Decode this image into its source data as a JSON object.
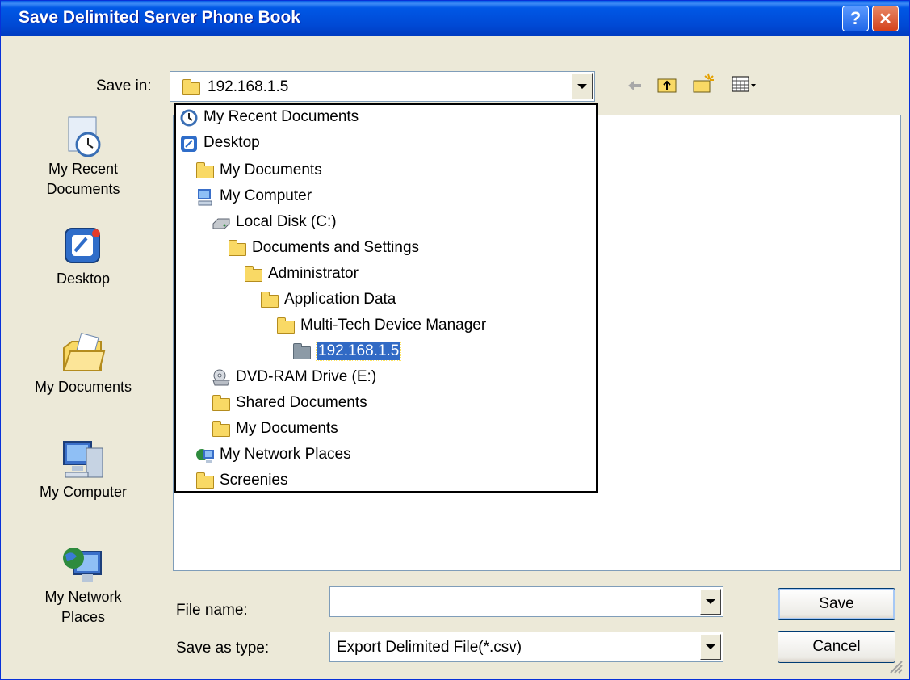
{
  "window": {
    "title": "Save Delimited Server Phone Book",
    "help_label": "?",
    "close_label": "✕"
  },
  "save_in": {
    "label": "Save in:",
    "value": "192.168.1.5"
  },
  "places_bar": [
    {
      "label": "My Recent Documents",
      "line1": "My Recent",
      "line2": "Documents",
      "icon": "recent-documents-icon"
    },
    {
      "label": "Desktop",
      "line1": "Desktop",
      "line2": "",
      "icon": "desktop-icon"
    },
    {
      "label": "My Documents",
      "line1": "My Documents",
      "line2": "",
      "icon": "my-documents-icon"
    },
    {
      "label": "My Computer",
      "line1": "My Computer",
      "line2": "",
      "icon": "my-computer-icon"
    },
    {
      "label": "My Network Places",
      "line1": "My Network",
      "line2": "Places",
      "icon": "network-places-icon"
    }
  ],
  "dropdown_items": [
    {
      "label": "My Recent Documents",
      "icon": "recent-documents-icon",
      "selected": false
    },
    {
      "label": "Desktop",
      "icon": "desktop-icon",
      "selected": false
    },
    {
      "label": "My Documents",
      "icon": "my-documents-icon",
      "selected": false
    },
    {
      "label": "My Computer",
      "icon": "my-computer-icon",
      "selected": false
    },
    {
      "label": "Local Disk (C:)",
      "icon": "hard-disk-icon",
      "selected": false
    },
    {
      "label": "Documents and Settings",
      "icon": "folder-icon",
      "selected": false
    },
    {
      "label": "Administrator",
      "icon": "folder-icon",
      "selected": false
    },
    {
      "label": "Application Data",
      "icon": "folder-icon",
      "selected": false
    },
    {
      "label": "Multi-Tech Device Manager",
      "icon": "folder-icon",
      "selected": false
    },
    {
      "label": "192.168.1.5",
      "icon": "folder-icon",
      "selected": true
    },
    {
      "label": "DVD-RAM Drive (E:)",
      "icon": "dvd-drive-icon",
      "selected": false
    },
    {
      "label": "Shared Documents",
      "icon": "folder-icon",
      "selected": false
    },
    {
      "label": "My Documents",
      "icon": "folder-icon",
      "selected": false
    },
    {
      "label": "My Network Places",
      "icon": "network-places-icon",
      "selected": false
    },
    {
      "label": "Screenies",
      "icon": "folder-icon",
      "selected": false
    }
  ],
  "file_name": {
    "label": "File name:",
    "value": ""
  },
  "save_as_type": {
    "label": "Save as type:",
    "value": "Export Delimited File(*.csv)"
  },
  "buttons": {
    "save": "Save",
    "cancel": "Cancel"
  },
  "colors": {
    "title_bar": "#0054E3",
    "dialog_bg": "#ECE9D8",
    "selection": "#316AC5"
  }
}
